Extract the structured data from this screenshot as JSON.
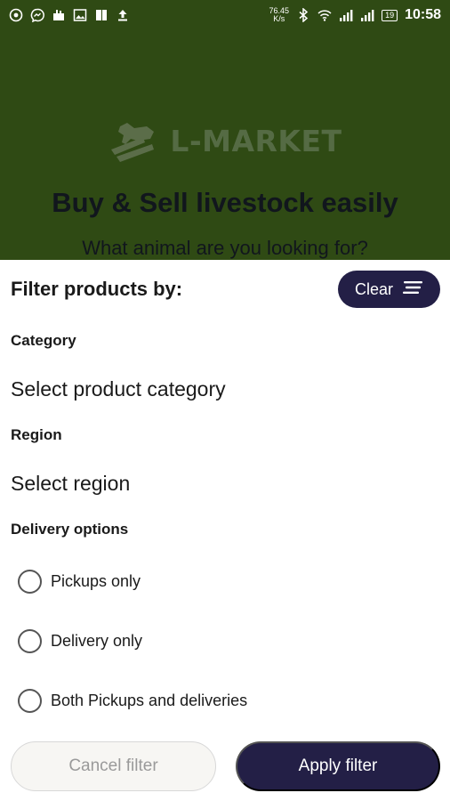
{
  "status_bar": {
    "net_speed_value": "76.45",
    "net_speed_unit": "K/s",
    "battery": "19",
    "time": "10:58",
    "left_icons": [
      "chrome-icon",
      "messenger-icon",
      "notification-icon",
      "gallery-icon",
      "files-icon",
      "upload-icon"
    ],
    "right_icons": [
      "bluetooth-icon",
      "wifi-icon",
      "signal-icon",
      "signal-icon"
    ]
  },
  "background": {
    "brand": "L-MARKET",
    "headline": "Buy & Sell livestock easily",
    "subline": "What animal are you looking for?"
  },
  "filter_sheet": {
    "title": "Filter products by:",
    "clear_label": "Clear",
    "category": {
      "label": "Category",
      "value": "Select product category"
    },
    "region": {
      "label": "Region",
      "value": "Select region"
    },
    "delivery": {
      "label": "Delivery options",
      "options": [
        {
          "label": "Pickups only",
          "selected": false
        },
        {
          "label": "Delivery only",
          "selected": false
        },
        {
          "label": "Both Pickups and deliveries",
          "selected": false
        }
      ]
    },
    "cancel_label": "Cancel filter",
    "apply_label": "Apply filter"
  },
  "colors": {
    "header_bg": "#2f4a14",
    "primary": "#231f46",
    "disabled_text": "#9a9a9a"
  }
}
